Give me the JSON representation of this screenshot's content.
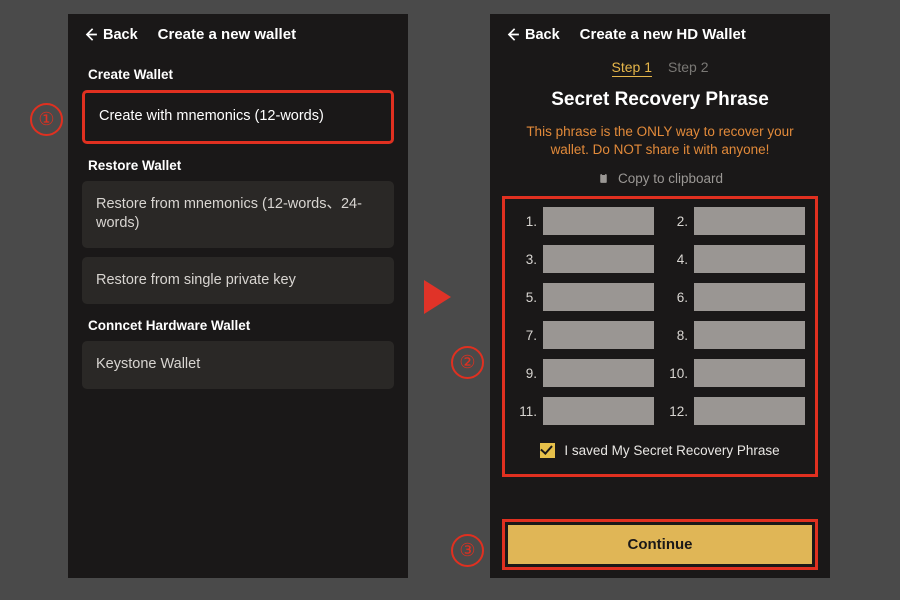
{
  "callouts": {
    "one": "①",
    "two": "②",
    "three": "③"
  },
  "left": {
    "back": "Back",
    "title": "Create a new wallet",
    "sections": {
      "create_label": "Create Wallet",
      "create_option": "Create with mnemonics (12-words)",
      "restore_label": "Restore Wallet",
      "restore_mnemonic": "Restore from mnemonics (12-words、24-words)",
      "restore_pk": "Restore from single private key",
      "hw_label": "Conncet Hardware Wallet",
      "hw_option": "Keystone Wallet"
    }
  },
  "right": {
    "back": "Back",
    "title": "Create a new HD Wallet",
    "steps": {
      "s1": "Step 1",
      "s2": "Step 2"
    },
    "heading": "Secret Recovery Phrase",
    "warning": "This phrase is the ONLY way to recover your wallet. Do NOT share it with anyone!",
    "copy_label": "Copy to clipboard",
    "word_numbers": [
      "1.",
      "2.",
      "3.",
      "4.",
      "5.",
      "6.",
      "7.",
      "8.",
      "9.",
      "10.",
      "11.",
      "12."
    ],
    "saved_label": "I saved My Secret Recovery Phrase",
    "saved_checked": true,
    "continue": "Continue"
  }
}
